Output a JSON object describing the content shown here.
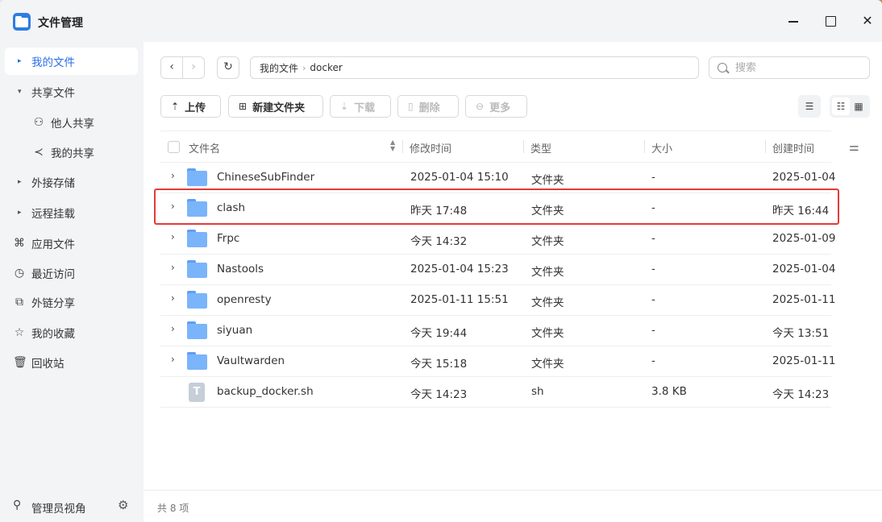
{
  "app": {
    "title": "文件管理"
  },
  "sidebar": {
    "items": [
      {
        "label": "我的文件"
      },
      {
        "label": "共享文件"
      },
      {
        "label": "他人共享"
      },
      {
        "label": "我的共享"
      },
      {
        "label": "外接存储"
      },
      {
        "label": "远程挂载"
      },
      {
        "label": "应用文件"
      },
      {
        "label": "最近访问"
      },
      {
        "label": "外链分享"
      },
      {
        "label": "我的收藏"
      },
      {
        "label": "回收站"
      }
    ],
    "bottom_label": "管理员视角"
  },
  "path": {
    "root": "我的文件",
    "current": "docker"
  },
  "search": {
    "placeholder": "搜索"
  },
  "toolbar": {
    "upload": "上传",
    "new_folder": "新建文件夹",
    "download": "下载",
    "delete": "删除",
    "more": "更多"
  },
  "table": {
    "headers": {
      "name": "文件名",
      "mtime": "修改时间",
      "type": "类型",
      "size": "大小",
      "ctime": "创建时间"
    },
    "rows": [
      {
        "name": "ChineseSubFinder",
        "mtime": "2025-01-04 15:10",
        "type": "文件夹",
        "size": "-",
        "ctime": "2025-01-04"
      },
      {
        "name": "clash",
        "mtime": "昨天 17:48",
        "type": "文件夹",
        "size": "-",
        "ctime": "昨天 16:44"
      },
      {
        "name": "Frpc",
        "mtime": "今天 14:32",
        "type": "文件夹",
        "size": "-",
        "ctime": "2025-01-09"
      },
      {
        "name": "Nastools",
        "mtime": "2025-01-04 15:23",
        "type": "文件夹",
        "size": "-",
        "ctime": "2025-01-04"
      },
      {
        "name": "openresty",
        "mtime": "2025-01-11 15:51",
        "type": "文件夹",
        "size": "-",
        "ctime": "2025-01-11"
      },
      {
        "name": "siyuan",
        "mtime": "今天 19:44",
        "type": "文件夹",
        "size": "-",
        "ctime": "今天 13:51"
      },
      {
        "name": "Vaultwarden",
        "mtime": "今天 15:18",
        "type": "文件夹",
        "size": "-",
        "ctime": "2025-01-11"
      },
      {
        "name": "backup_docker.sh",
        "mtime": "今天 14:23",
        "type": "sh",
        "size": "3.8 KB",
        "ctime": "今天 14:23",
        "file_icon": "T"
      }
    ]
  },
  "status": {
    "count": "共 8 项"
  },
  "colors": {
    "accent": "#2a6ee8",
    "highlight_border": "#e43a3a",
    "folder": "#7ab4fb"
  }
}
